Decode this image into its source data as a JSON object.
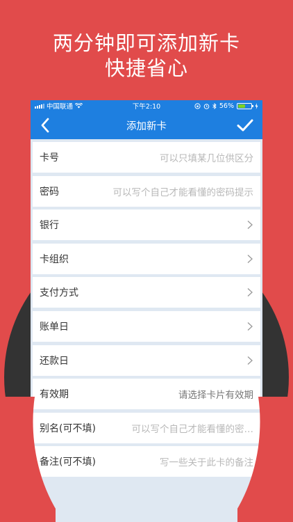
{
  "headline": {
    "line1": "两分钟即可添加新卡",
    "line2": "快捷省心"
  },
  "status_bar": {
    "carrier": "中国联通",
    "time": "下午2:10",
    "battery": "56%",
    "battery_level": 0.56
  },
  "nav": {
    "title": "添加新卡"
  },
  "form": {
    "fields": [
      {
        "label": "卡号",
        "placeholder": "可以只填某几位供区分"
      },
      {
        "label": "密码",
        "placeholder": "可以写个自己才能看懂的密码提示"
      },
      {
        "label": "银行"
      },
      {
        "label": "卡组织"
      },
      {
        "label": "支付方式"
      },
      {
        "label": "账单日"
      },
      {
        "label": "还款日"
      },
      {
        "label": "有效期",
        "value": "请选择卡片有效期"
      },
      {
        "label": "别名(可不填)",
        "placeholder": "可以写个自己才能看懂的密…"
      },
      {
        "label": "备注(可不填)",
        "placeholder": "写一些关于此卡的备注"
      }
    ]
  },
  "colors": {
    "background": "#e14b4b",
    "circle": "#333333",
    "primary": "#1e7fe0",
    "battery": "#7ed321"
  }
}
